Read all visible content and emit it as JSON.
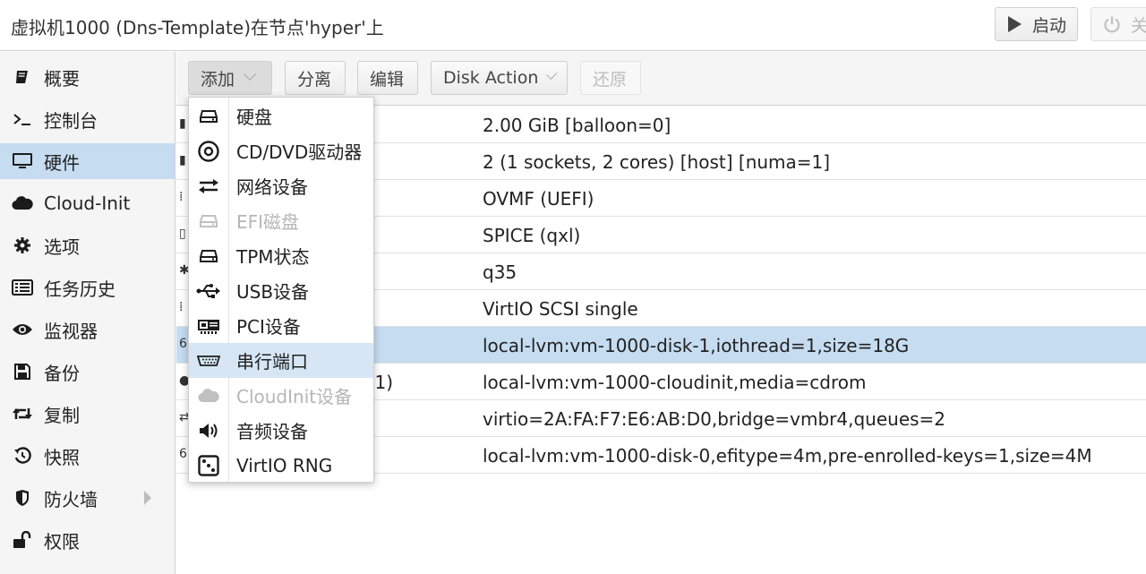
{
  "header": {
    "title": "虚拟机1000 (Dns-Template)在节点'hyper'上",
    "start_label": "启动",
    "shutdown_label": "关"
  },
  "sidebar": {
    "items": [
      {
        "label": "概要",
        "icon": "book-icon"
      },
      {
        "label": "控制台",
        "icon": "terminal-icon"
      },
      {
        "label": "硬件",
        "icon": "monitor-icon",
        "active": true
      },
      {
        "label": "Cloud-Init",
        "icon": "cloud-icon"
      },
      {
        "label": "选项",
        "icon": "gear-icon"
      },
      {
        "label": "任务历史",
        "icon": "list-icon"
      },
      {
        "label": "监视器",
        "icon": "eye-icon"
      },
      {
        "label": "备份",
        "icon": "floppy-icon"
      },
      {
        "label": "复制",
        "icon": "retweet-icon"
      },
      {
        "label": "快照",
        "icon": "history-icon"
      },
      {
        "label": "防火墙",
        "icon": "shield-icon"
      },
      {
        "label": "权限",
        "icon": "unlock-icon"
      }
    ]
  },
  "toolbar": {
    "add_label": "添加",
    "detach_label": "分离",
    "edit_label": "编辑",
    "disk_action_label": "Disk Action",
    "revert_label": "还原"
  },
  "hardware": {
    "rows": [
      {
        "key": "",
        "value": "2.00 GiB [balloon=0]"
      },
      {
        "key": "",
        "value": "2 (1 sockets, 2 cores) [host] [numa=1]"
      },
      {
        "key": "",
        "value": "OVMF (UEFI)"
      },
      {
        "key": "",
        "value": "SPICE (qxl)"
      },
      {
        "key": "",
        "value": "q35"
      },
      {
        "key": "",
        "value": "VirtIO SCSI single"
      },
      {
        "key": "",
        "value": "local-lvm:vm-1000-disk-1,iothread=1,size=18G",
        "selected": true
      },
      {
        "key": "i1)",
        "value": "local-lvm:vm-1000-cloudinit,media=cdrom"
      },
      {
        "key": "",
        "value": "virtio=2A:FA:F7:E6:AB:D0,bridge=vmbr4,queues=2"
      },
      {
        "key": "",
        "value": "local-lvm:vm-1000-disk-0,efitype=4m,pre-enrolled-keys=1,size=4M"
      }
    ]
  },
  "add_menu": {
    "items": [
      {
        "label": "硬盘",
        "icon": "hdd-icon"
      },
      {
        "label": "CD/DVD驱动器",
        "icon": "disc-icon"
      },
      {
        "label": "网络设备",
        "icon": "exchange-icon"
      },
      {
        "label": "EFI磁盘",
        "icon": "hdd-icon",
        "disabled": true
      },
      {
        "label": "TPM状态",
        "icon": "hdd-icon"
      },
      {
        "label": "USB设备",
        "icon": "usb-icon"
      },
      {
        "label": "PCI设备",
        "icon": "pci-card-icon"
      },
      {
        "label": "串行端口",
        "icon": "serial-port-icon",
        "hover": true
      },
      {
        "label": "CloudInit设备",
        "icon": "cloud-icon",
        "disabled": true
      },
      {
        "label": "音频设备",
        "icon": "volume-icon"
      },
      {
        "label": "VirtIO RNG",
        "icon": "dice-icon"
      }
    ]
  }
}
